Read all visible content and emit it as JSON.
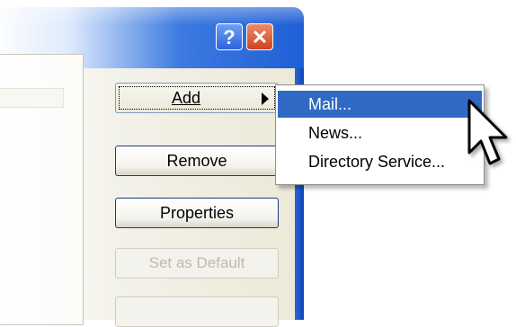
{
  "window": {
    "title_buttons": {
      "help_label": "?",
      "close_label": "✕"
    }
  },
  "buttons": {
    "add": "Add",
    "remove": "Remove",
    "properties": "Properties",
    "set_default": "Set as Default"
  },
  "menu": {
    "items": [
      {
        "label": "Mail...",
        "selected": true
      },
      {
        "label": "News..."
      },
      {
        "label": "Directory Service..."
      }
    ]
  },
  "colors": {
    "selection": "#316ac5",
    "title_blue": "#1f5fd6",
    "close_red": "#d2421f"
  },
  "icons": [
    "help-icon",
    "close-icon",
    "submenu-arrow-icon",
    "mouse-pointer-icon"
  ]
}
